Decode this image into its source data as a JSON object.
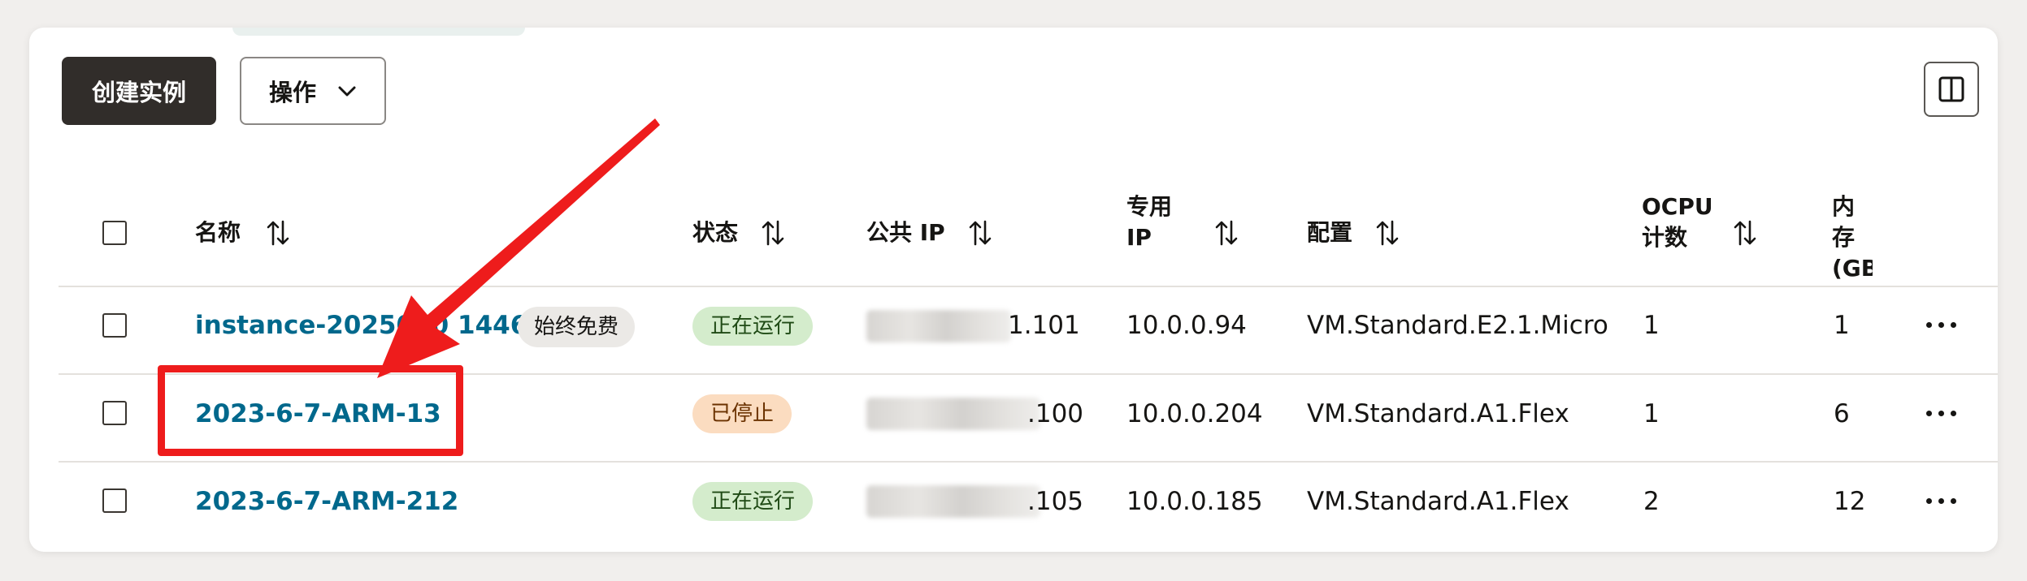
{
  "toolbar": {
    "create_label": "创建实例",
    "actions_label": "操作",
    "columns_icon": "columns-icon"
  },
  "table": {
    "columns": [
      {
        "label": "名称",
        "sortable": true
      },
      {
        "label": "状态",
        "sortable": true
      },
      {
        "label": "公共 IP",
        "sortable": true
      },
      {
        "label_line1": "专用",
        "label_line2": "IP",
        "sortable": true
      },
      {
        "label": "配置",
        "sortable": true
      },
      {
        "label_line1": "OCPU",
        "label_line2": "计数",
        "sortable": true
      },
      {
        "label_line1": "内存",
        "label_line2": "(GB",
        "sortable": false
      }
    ],
    "rows": [
      {
        "name": "instance-2025060  1446",
        "badge": "始终免费",
        "status": "正在运行",
        "status_kind": "running",
        "public_ip_suffix": "1.101",
        "private_ip": "10.0.0.94",
        "shape": "VM.Standard.E2.1.Micro",
        "ocpu": "1",
        "memory": "1"
      },
      {
        "name": "2023-6-7-ARM-13",
        "badge": "",
        "status": "已停止",
        "status_kind": "stopped",
        "public_ip_suffix": ".100",
        "private_ip": "10.0.0.204",
        "shape": "VM.Standard.A1.Flex",
        "ocpu": "1",
        "memory": "6"
      },
      {
        "name": "2023-6-7-ARM-212",
        "badge": "",
        "status": "正在运行",
        "status_kind": "running",
        "public_ip_suffix": ".105",
        "private_ip": "10.0.0.185",
        "shape": "VM.Standard.A1.Flex",
        "ocpu": "2",
        "memory": "12"
      }
    ]
  },
  "colors": {
    "primary_button": "#312d2a",
    "link": "#00688c",
    "running_badge": "#d4eccc",
    "stopped_badge": "#fbdcc0",
    "annotation": "#ee1c1c"
  }
}
